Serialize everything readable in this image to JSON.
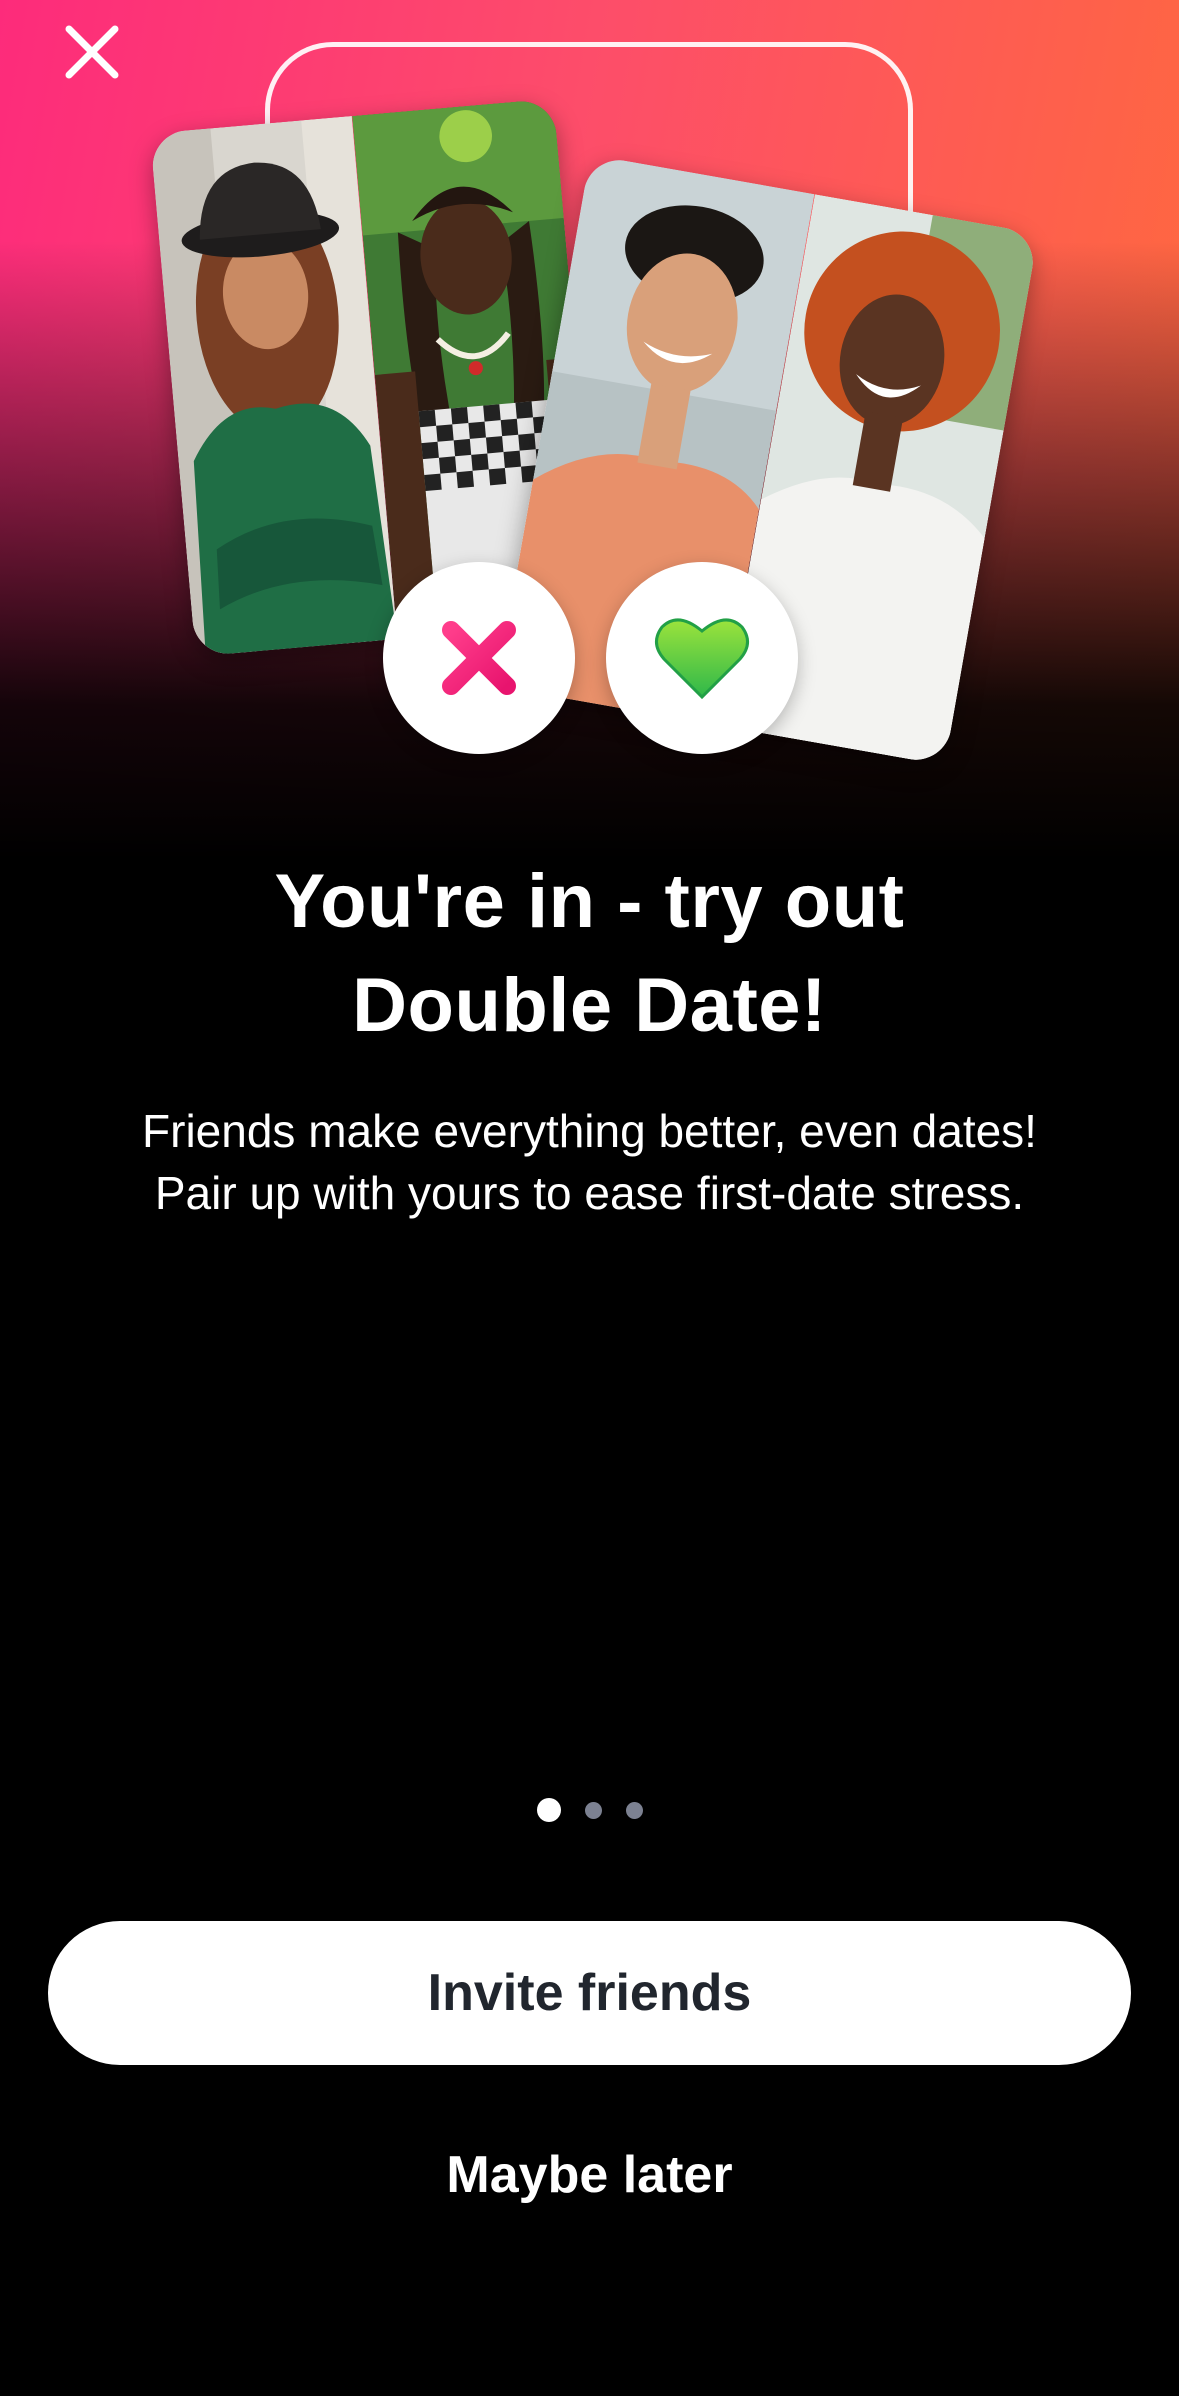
{
  "header": {
    "close_icon": "close-icon"
  },
  "hero": {
    "nope_icon": "x-icon",
    "like_icon": "heart-icon",
    "photos": [
      "profile-photo-woman-bucket-hat",
      "profile-photo-woman-braids",
      "profile-photo-man-curly-hair",
      "profile-photo-man-red-afro"
    ],
    "colors": {
      "gradient_start": "#fd2b7b",
      "gradient_end": "#ff6a3c",
      "nope_pink": "#f0207a",
      "like_green": "#5fd43a"
    }
  },
  "content": {
    "title_line1": "You're in - try out",
    "title_line2": "Double Date!",
    "description_line1": "Friends make everything better, even dates!",
    "description_line2": "Pair up with yours to ease first-date stress."
  },
  "pager": {
    "current": 1,
    "total": 3
  },
  "actions": {
    "invite_label": "Invite friends",
    "later_label": "Maybe later"
  }
}
